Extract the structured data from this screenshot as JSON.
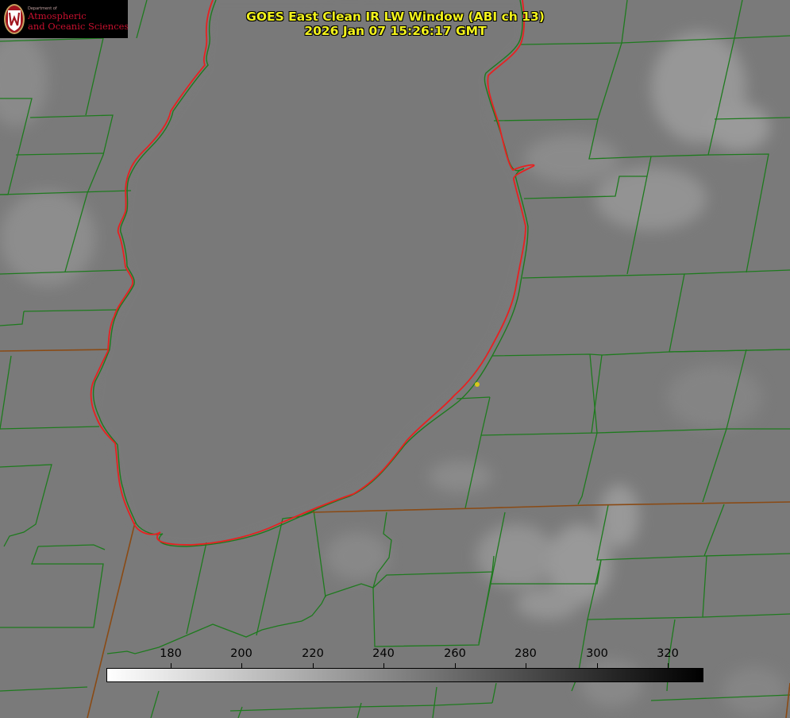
{
  "logo": {
    "dept_text": "Department of",
    "line1": "Atmospheric",
    "line2": "and Oceanic Sciences"
  },
  "title": {
    "line1": "GOES East Clean IR LW Window (ABI ch 13)",
    "line2": "2026 Jan 07 15:26:17 GMT"
  },
  "colorbar": {
    "ticks": [
      "180",
      "200",
      "220",
      "240",
      "260",
      "280",
      "300",
      "320"
    ],
    "min_color": "#ffffff",
    "max_color": "#000000"
  },
  "colors": {
    "title_text": "#f2f21c",
    "county_lines": "#1e7a1e",
    "lake_outline": "#e82020",
    "state_lines": "#8a4a14",
    "marker": "#d8c81a"
  }
}
